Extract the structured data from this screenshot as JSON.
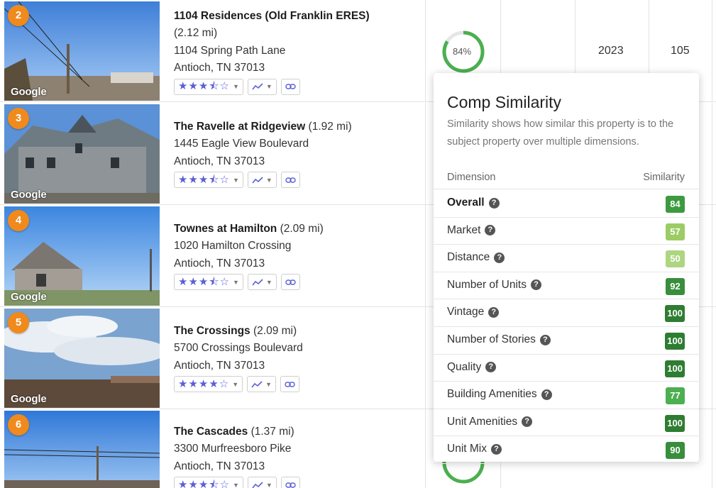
{
  "rows": [
    {
      "rank": "2",
      "name": "1104 Residences (Old Franklin ERES)",
      "distance": "(2.12 mi)",
      "address": "1104 Spring Path Lane",
      "city": "Antioch, TN 37013",
      "stars": "★★★⯪☆",
      "similarity": "84%",
      "year": "2023",
      "units": "105"
    },
    {
      "rank": "3",
      "name": "The Ravelle at Ridgeview",
      "distance": "(1.92 mi)",
      "address": "1445 Eagle View Boulevard",
      "city": "Antioch, TN 37013",
      "stars": "★★★⯪☆"
    },
    {
      "rank": "4",
      "name": "Townes at Hamilton",
      "distance": "(2.09 mi)",
      "address": "1020 Hamilton Crossing",
      "city": "Antioch, TN 37013",
      "stars": "★★★⯪☆"
    },
    {
      "rank": "5",
      "name": "The Crossings",
      "distance": "(2.09 mi)",
      "address": "5700 Crossings Boulevard",
      "city": "Antioch, TN 37013",
      "stars": "★★★★☆"
    },
    {
      "rank": "6",
      "name": "The Cascades",
      "distance": "(1.37 mi)",
      "address": "3300 Murfreesboro Pike",
      "city": "Antioch, TN 37013",
      "stars": "★★★⯪☆"
    }
  ],
  "photo_watermark": "Google",
  "popup": {
    "title": "Comp Similarity",
    "description": "Similarity shows how similar this property is to the subject property over multiple dimensions.",
    "col_dimension": "Dimension",
    "col_similarity": "Similarity",
    "rows": [
      {
        "label": "Overall",
        "score": "84",
        "color": "#3d9a3f"
      },
      {
        "label": "Market",
        "score": "57",
        "color": "#9ccc65"
      },
      {
        "label": "Distance",
        "score": "50",
        "color": "#aed581"
      },
      {
        "label": "Number of Units",
        "score": "92",
        "color": "#388e3c"
      },
      {
        "label": "Vintage",
        "score": "100",
        "color": "#2e7d32"
      },
      {
        "label": "Number of Stories",
        "score": "100",
        "color": "#2e7d32"
      },
      {
        "label": "Quality",
        "score": "100",
        "color": "#2e7d32"
      },
      {
        "label": "Building Amenities",
        "score": "77",
        "color": "#4caf50"
      },
      {
        "label": "Unit Amenities",
        "score": "100",
        "color": "#2e7d32"
      },
      {
        "label": "Unit Mix",
        "score": "90",
        "color": "#388e3c"
      }
    ],
    "help_glyph": "?"
  },
  "colors": {
    "accent": "#5a5fd6",
    "badge": "#f08a1c",
    "ring": "#4caf50"
  },
  "icons": {
    "rating": "star-rating-icon",
    "trend": "trend-line-icon",
    "link": "link-icon",
    "help": "help-circle-icon"
  }
}
